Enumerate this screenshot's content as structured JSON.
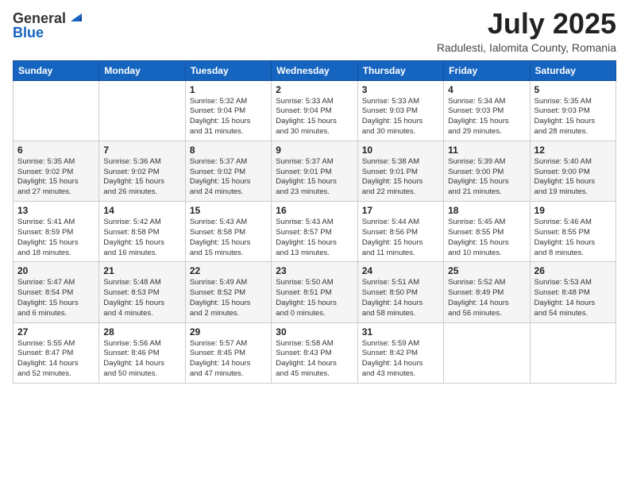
{
  "header": {
    "logo_general": "General",
    "logo_blue": "Blue",
    "title": "July 2025",
    "location": "Radulesti, Ialomita County, Romania"
  },
  "weekdays": [
    "Sunday",
    "Monday",
    "Tuesday",
    "Wednesday",
    "Thursday",
    "Friday",
    "Saturday"
  ],
  "weeks": [
    [
      {
        "day": "",
        "info": ""
      },
      {
        "day": "",
        "info": ""
      },
      {
        "day": "1",
        "info": "Sunrise: 5:32 AM\nSunset: 9:04 PM\nDaylight: 15 hours\nand 31 minutes."
      },
      {
        "day": "2",
        "info": "Sunrise: 5:33 AM\nSunset: 9:04 PM\nDaylight: 15 hours\nand 30 minutes."
      },
      {
        "day": "3",
        "info": "Sunrise: 5:33 AM\nSunset: 9:03 PM\nDaylight: 15 hours\nand 30 minutes."
      },
      {
        "day": "4",
        "info": "Sunrise: 5:34 AM\nSunset: 9:03 PM\nDaylight: 15 hours\nand 29 minutes."
      },
      {
        "day": "5",
        "info": "Sunrise: 5:35 AM\nSunset: 9:03 PM\nDaylight: 15 hours\nand 28 minutes."
      }
    ],
    [
      {
        "day": "6",
        "info": "Sunrise: 5:35 AM\nSunset: 9:02 PM\nDaylight: 15 hours\nand 27 minutes."
      },
      {
        "day": "7",
        "info": "Sunrise: 5:36 AM\nSunset: 9:02 PM\nDaylight: 15 hours\nand 26 minutes."
      },
      {
        "day": "8",
        "info": "Sunrise: 5:37 AM\nSunset: 9:02 PM\nDaylight: 15 hours\nand 24 minutes."
      },
      {
        "day": "9",
        "info": "Sunrise: 5:37 AM\nSunset: 9:01 PM\nDaylight: 15 hours\nand 23 minutes."
      },
      {
        "day": "10",
        "info": "Sunrise: 5:38 AM\nSunset: 9:01 PM\nDaylight: 15 hours\nand 22 minutes."
      },
      {
        "day": "11",
        "info": "Sunrise: 5:39 AM\nSunset: 9:00 PM\nDaylight: 15 hours\nand 21 minutes."
      },
      {
        "day": "12",
        "info": "Sunrise: 5:40 AM\nSunset: 9:00 PM\nDaylight: 15 hours\nand 19 minutes."
      }
    ],
    [
      {
        "day": "13",
        "info": "Sunrise: 5:41 AM\nSunset: 8:59 PM\nDaylight: 15 hours\nand 18 minutes."
      },
      {
        "day": "14",
        "info": "Sunrise: 5:42 AM\nSunset: 8:58 PM\nDaylight: 15 hours\nand 16 minutes."
      },
      {
        "day": "15",
        "info": "Sunrise: 5:43 AM\nSunset: 8:58 PM\nDaylight: 15 hours\nand 15 minutes."
      },
      {
        "day": "16",
        "info": "Sunrise: 5:43 AM\nSunset: 8:57 PM\nDaylight: 15 hours\nand 13 minutes."
      },
      {
        "day": "17",
        "info": "Sunrise: 5:44 AM\nSunset: 8:56 PM\nDaylight: 15 hours\nand 11 minutes."
      },
      {
        "day": "18",
        "info": "Sunrise: 5:45 AM\nSunset: 8:55 PM\nDaylight: 15 hours\nand 10 minutes."
      },
      {
        "day": "19",
        "info": "Sunrise: 5:46 AM\nSunset: 8:55 PM\nDaylight: 15 hours\nand 8 minutes."
      }
    ],
    [
      {
        "day": "20",
        "info": "Sunrise: 5:47 AM\nSunset: 8:54 PM\nDaylight: 15 hours\nand 6 minutes."
      },
      {
        "day": "21",
        "info": "Sunrise: 5:48 AM\nSunset: 8:53 PM\nDaylight: 15 hours\nand 4 minutes."
      },
      {
        "day": "22",
        "info": "Sunrise: 5:49 AM\nSunset: 8:52 PM\nDaylight: 15 hours\nand 2 minutes."
      },
      {
        "day": "23",
        "info": "Sunrise: 5:50 AM\nSunset: 8:51 PM\nDaylight: 15 hours\nand 0 minutes."
      },
      {
        "day": "24",
        "info": "Sunrise: 5:51 AM\nSunset: 8:50 PM\nDaylight: 14 hours\nand 58 minutes."
      },
      {
        "day": "25",
        "info": "Sunrise: 5:52 AM\nSunset: 8:49 PM\nDaylight: 14 hours\nand 56 minutes."
      },
      {
        "day": "26",
        "info": "Sunrise: 5:53 AM\nSunset: 8:48 PM\nDaylight: 14 hours\nand 54 minutes."
      }
    ],
    [
      {
        "day": "27",
        "info": "Sunrise: 5:55 AM\nSunset: 8:47 PM\nDaylight: 14 hours\nand 52 minutes."
      },
      {
        "day": "28",
        "info": "Sunrise: 5:56 AM\nSunset: 8:46 PM\nDaylight: 14 hours\nand 50 minutes."
      },
      {
        "day": "29",
        "info": "Sunrise: 5:57 AM\nSunset: 8:45 PM\nDaylight: 14 hours\nand 47 minutes."
      },
      {
        "day": "30",
        "info": "Sunrise: 5:58 AM\nSunset: 8:43 PM\nDaylight: 14 hours\nand 45 minutes."
      },
      {
        "day": "31",
        "info": "Sunrise: 5:59 AM\nSunset: 8:42 PM\nDaylight: 14 hours\nand 43 minutes."
      },
      {
        "day": "",
        "info": ""
      },
      {
        "day": "",
        "info": ""
      }
    ]
  ]
}
